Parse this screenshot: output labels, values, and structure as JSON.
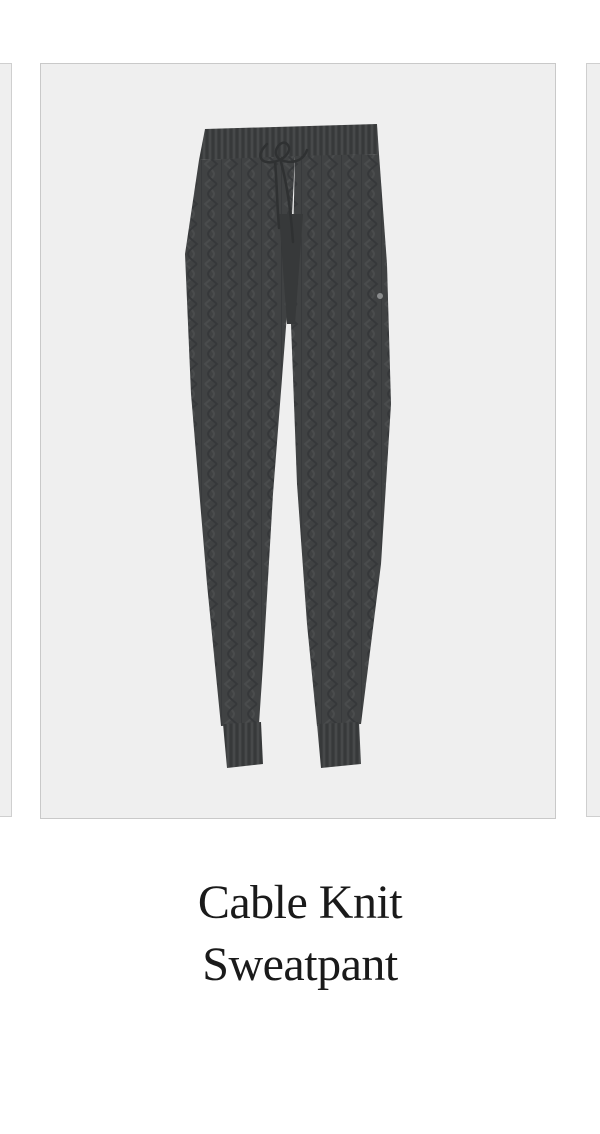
{
  "product": {
    "title_line1": "Cable Knit",
    "title_line2": "Sweatpant",
    "image_icon": "cable-knit-sweatpant-image"
  },
  "colors": {
    "card_background": "#efefef",
    "garment": "#3f4142",
    "title_text": "#1a1a1a"
  }
}
